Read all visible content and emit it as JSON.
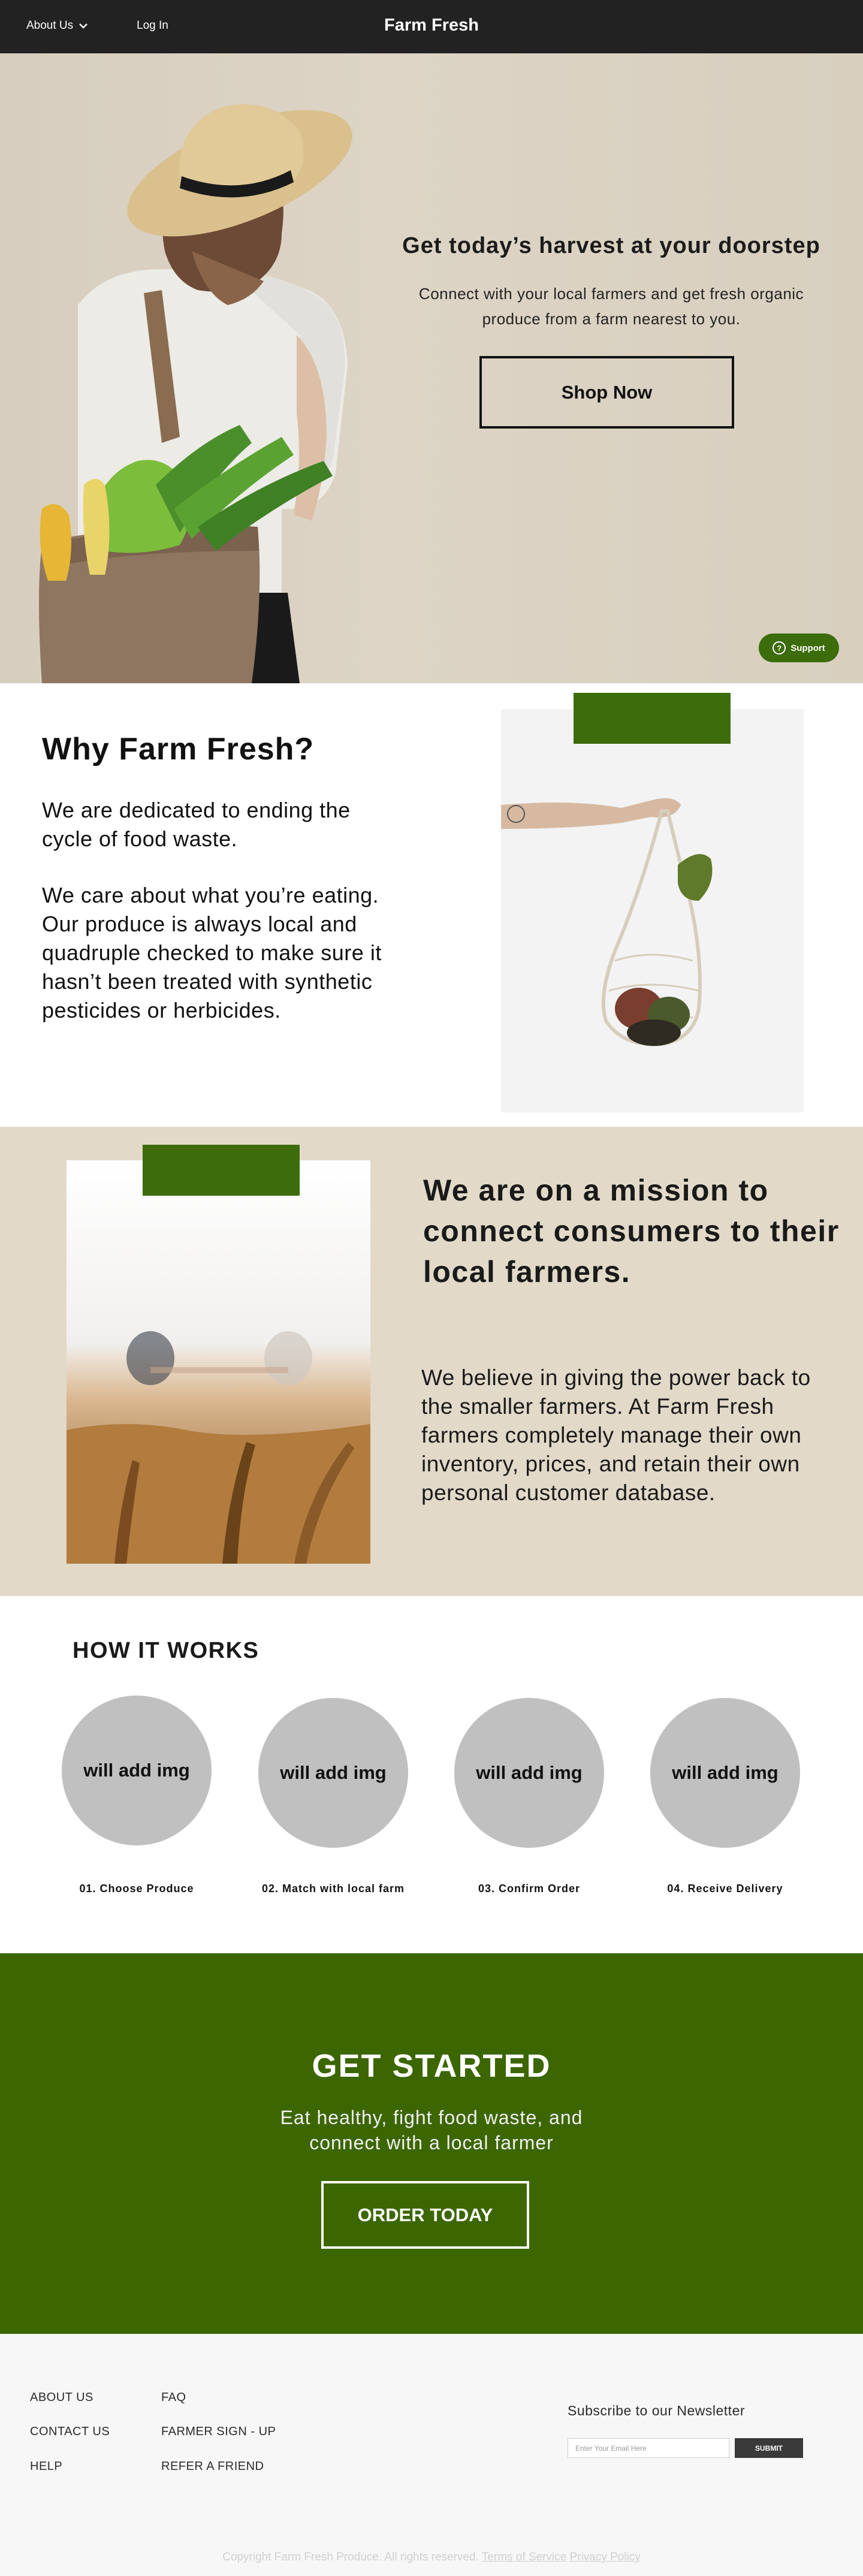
{
  "header": {
    "about_label": "About Us",
    "login_label": "Log In",
    "brand": "Farm Fresh"
  },
  "hero": {
    "title": "Get today’s harvest at your doorstep",
    "subtitle": "Connect with your local farmers and get fresh organic produce from a farm nearest to you.",
    "cta_label": "Shop Now",
    "support_label": "Support"
  },
  "why": {
    "title": "Why Farm Fresh?",
    "paragraph_1": "We are dedicated to ending the cycle of food waste.",
    "paragraph_2": "We care about what you’re eating. Our produce is always local and quadruple checked to make sure it hasn’t been treated with synthetic pesticides or herbicides."
  },
  "mission": {
    "title": "We are on a mission to connect consumers to their local farmers.",
    "text": "We believe in giving the power back to the smaller farmers. At Farm Fresh farmers completely manage their own inventory, prices, and retain their own personal customer database."
  },
  "how_it_works": {
    "title": "HOW IT WORKS",
    "steps": [
      {
        "placeholder": "will add img",
        "label": "01. Choose Produce"
      },
      {
        "placeholder": "will add img",
        "label": "02. Match with local farm"
      },
      {
        "placeholder": "will add img",
        "label": "03. Confirm Order"
      },
      {
        "placeholder": "will add img",
        "label": "04. Receive Delivery"
      }
    ]
  },
  "get_started": {
    "title": "GET STARTED",
    "subtitle": "Eat healthy, fight food waste, and connect with a local farmer",
    "button_label": "ORDER TODAY"
  },
  "footer": {
    "col1": [
      "ABOUT US",
      "CONTACT US",
      "HELP"
    ],
    "col2": [
      "FAQ",
      "FARMER SIGN - UP",
      "REFER A FRIEND"
    ],
    "newsletter_title": "Subscribe to our Newsletter",
    "email_placeholder": "Enter Your Email Here",
    "submit_label": "SUBMIT",
    "copyright": "Copyright Farm Fresh Produce. All rights reserved.",
    "terms_label": "Terms of Service",
    "privacy_label": "Privacy Policy"
  },
  "colors": {
    "brand_green": "#3c6600",
    "header_dark": "#222222",
    "hero_beige": "#d7cebf",
    "mission_beige": "#e2d9c8",
    "placeholder_gray": "#c0c0c0"
  },
  "icons": {
    "about_dropdown": "chevron-down-icon",
    "support": "question-icon"
  }
}
